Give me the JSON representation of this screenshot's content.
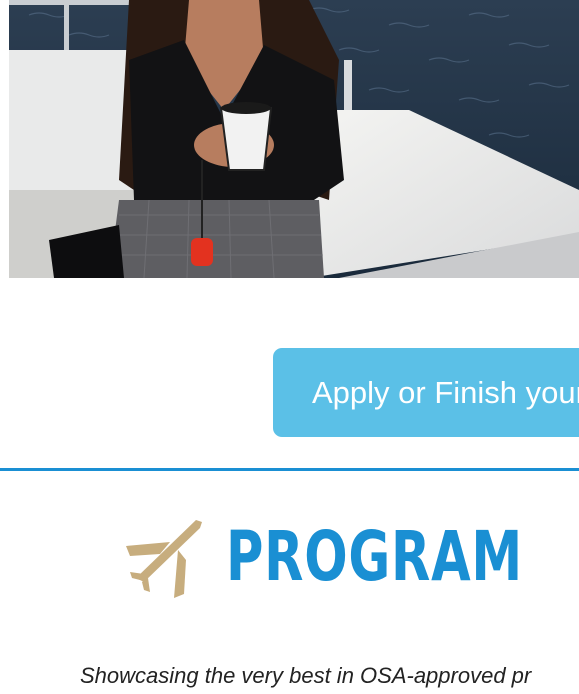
{
  "photo": {
    "alt": "Student holding a coffee cup on a boat deck over water"
  },
  "cta": {
    "label": "Apply or Finish your"
  },
  "program": {
    "title": "PROGRAM"
  },
  "tagline": "Showcasing the very best in OSA-approved pr",
  "colors": {
    "button": "#5bc0e7",
    "accent_blue": "#1a8fd3",
    "plane_gold": "#c7ad7e"
  },
  "icons": {
    "plane": "airplane-icon"
  }
}
